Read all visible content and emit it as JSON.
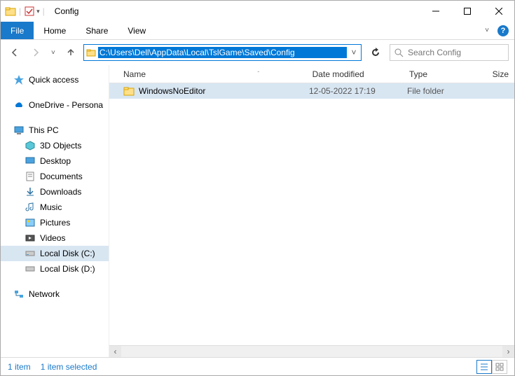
{
  "window": {
    "title": "Config"
  },
  "ribbon": {
    "file": "File",
    "tabs": [
      "Home",
      "Share",
      "View"
    ]
  },
  "address": {
    "path": "C:\\Users\\Dell\\AppData\\Local\\TslGame\\Saved\\Config"
  },
  "search": {
    "placeholder": "Search Config"
  },
  "sidebar": {
    "quick_access": "Quick access",
    "onedrive": "OneDrive - Persona",
    "this_pc": "This PC",
    "pc_items": [
      "3D Objects",
      "Desktop",
      "Documents",
      "Downloads",
      "Music",
      "Pictures",
      "Videos",
      "Local Disk (C:)",
      "Local Disk (D:)"
    ],
    "network": "Network"
  },
  "columns": {
    "name": "Name",
    "date": "Date modified",
    "type": "Type",
    "size": "Size"
  },
  "files": [
    {
      "name": "WindowsNoEditor",
      "date": "12-05-2022 17:19",
      "type": "File folder",
      "selected": true
    }
  ],
  "status": {
    "count": "1 item",
    "selected": "1 item selected"
  }
}
